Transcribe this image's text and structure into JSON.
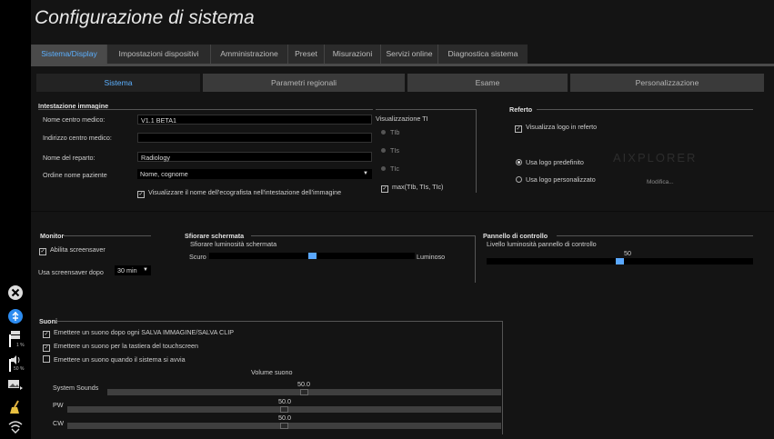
{
  "title": "Configurazione di sistema",
  "tabs": [
    {
      "label": "Sistema/Display"
    },
    {
      "label": "Impostazioni dispositivi"
    },
    {
      "label": "Amministrazione"
    },
    {
      "label": "Preset"
    },
    {
      "label": "Misurazioni"
    },
    {
      "label": "Servizi online"
    },
    {
      "label": "Diagnostica sistema"
    }
  ],
  "subtabs": [
    {
      "label": "Sistema"
    },
    {
      "label": "Parametri regionali"
    },
    {
      "label": "Esame"
    },
    {
      "label": "Personalizzazione"
    }
  ],
  "intestazione": {
    "title": "Intestazione immagine",
    "nome_centro_label": "Nome centro medico:",
    "nome_centro_value": "V1.1 BETA1",
    "indirizzo_label": "Indirizzo centro medico:",
    "indirizzo_value": "",
    "reparto_label": "Nome del reparto:",
    "reparto_value": "Radiology",
    "ordine_label": "Ordine nome paziente",
    "ordine_value": "Nome, cognome",
    "ecografista_label": "Visualizzare il nome dell'ecografista nell'intestazione dell'immagine"
  },
  "ti": {
    "title": "Visualizzazione TI",
    "options": [
      "TIb",
      "TIs",
      "TIc"
    ],
    "max_label": "max(TIb, TIs, TIc)"
  },
  "referto": {
    "title": "Referto",
    "logo_label": "Visualizza logo in referto",
    "predef_label": "Usa logo predefinito",
    "personal_label": "Usa logo personalizzato",
    "modifica_label": "Modifica...",
    "watermark": "AIXPLORER"
  },
  "monitor": {
    "title": "Monitor",
    "screensaver_label": "Abilita screensaver",
    "dopo_label": "Usa screensaver dopo",
    "dopo_value": "30 min"
  },
  "sfiorare": {
    "title": "Sfiorare schermata",
    "sub_label": "Sfiorare luminosità schermata",
    "left_label": "Scuro",
    "right_label": "Luminoso",
    "level": 0.5
  },
  "pannello": {
    "title": "Pannello di controllo",
    "sub_label": "Livello luminosità pannello di controllo",
    "value": "50",
    "level": 0.5
  },
  "suoni": {
    "title": "Suoni",
    "opt1": "Emettere un suono dopo ogni SALVA IMMAGINE/SALVA CLIP",
    "opt2": "Emettere un suono per la tastiera del touchscreen",
    "opt3": "Emettere un suono quando il sistema si avvia",
    "volume_label": "Volume suono",
    "sliders": [
      {
        "name": "System Sounds",
        "value": "50.0",
        "level": 0.5
      },
      {
        "name": "PW",
        "value": "50.0",
        "level": 0.5
      },
      {
        "name": "CW",
        "value": "50.0",
        "level": 0.5
      }
    ]
  },
  "sidebar": {
    "storage_pct": "1 %",
    "volume_pct": "50 %"
  },
  "colors": {
    "accent": "#5cb0ff",
    "slider_thumb": "#5aa8ff"
  }
}
